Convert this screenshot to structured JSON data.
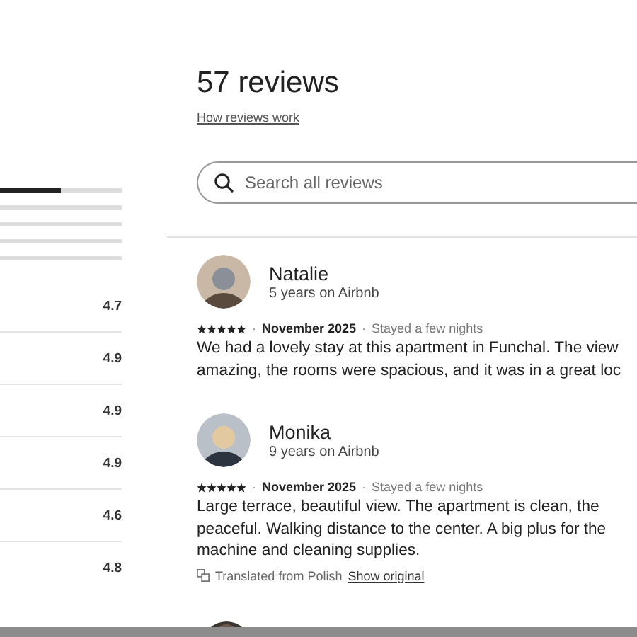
{
  "rating_bars": [
    {
      "level": 0.5
    },
    {
      "level": 0
    },
    {
      "level": 0
    },
    {
      "level": 0
    },
    {
      "level": 0
    }
  ],
  "category_ratings": [
    {
      "value": "4.7"
    },
    {
      "value": "4.9"
    },
    {
      "value": "4.9"
    },
    {
      "value": "4.9"
    },
    {
      "value": "4.6"
    },
    {
      "value": "4.8"
    }
  ],
  "reviews_header": {
    "title": "57 reviews",
    "link": "How reviews work"
  },
  "search": {
    "placeholder": "Search all reviews"
  },
  "reviews": [
    {
      "name": "Natalie",
      "tenure": "5 years on Airbnb",
      "stars": 5,
      "separator_1": "·",
      "date": "November 2025",
      "separator_2": "·",
      "stay": "Stayed a few nights",
      "lines": [
        "We had a lovely stay at this apartment in Funchal. The view",
        "amazing, the rooms were spacious, and it was in a great loc"
      ]
    },
    {
      "name": "Monika",
      "tenure": "9 years on Airbnb",
      "stars": 5,
      "separator_1": "·",
      "date": "November 2025",
      "separator_2": "·",
      "stay": "Stayed a few nights",
      "lines": [
        "Large terrace, beautiful view. The apartment is clean, the",
        "peaceful. Walking distance to the center. A big plus for the",
        "machine and cleaning supplies."
      ],
      "translation": {
        "note": "Translated from Polish",
        "link": "Show original"
      }
    }
  ]
}
